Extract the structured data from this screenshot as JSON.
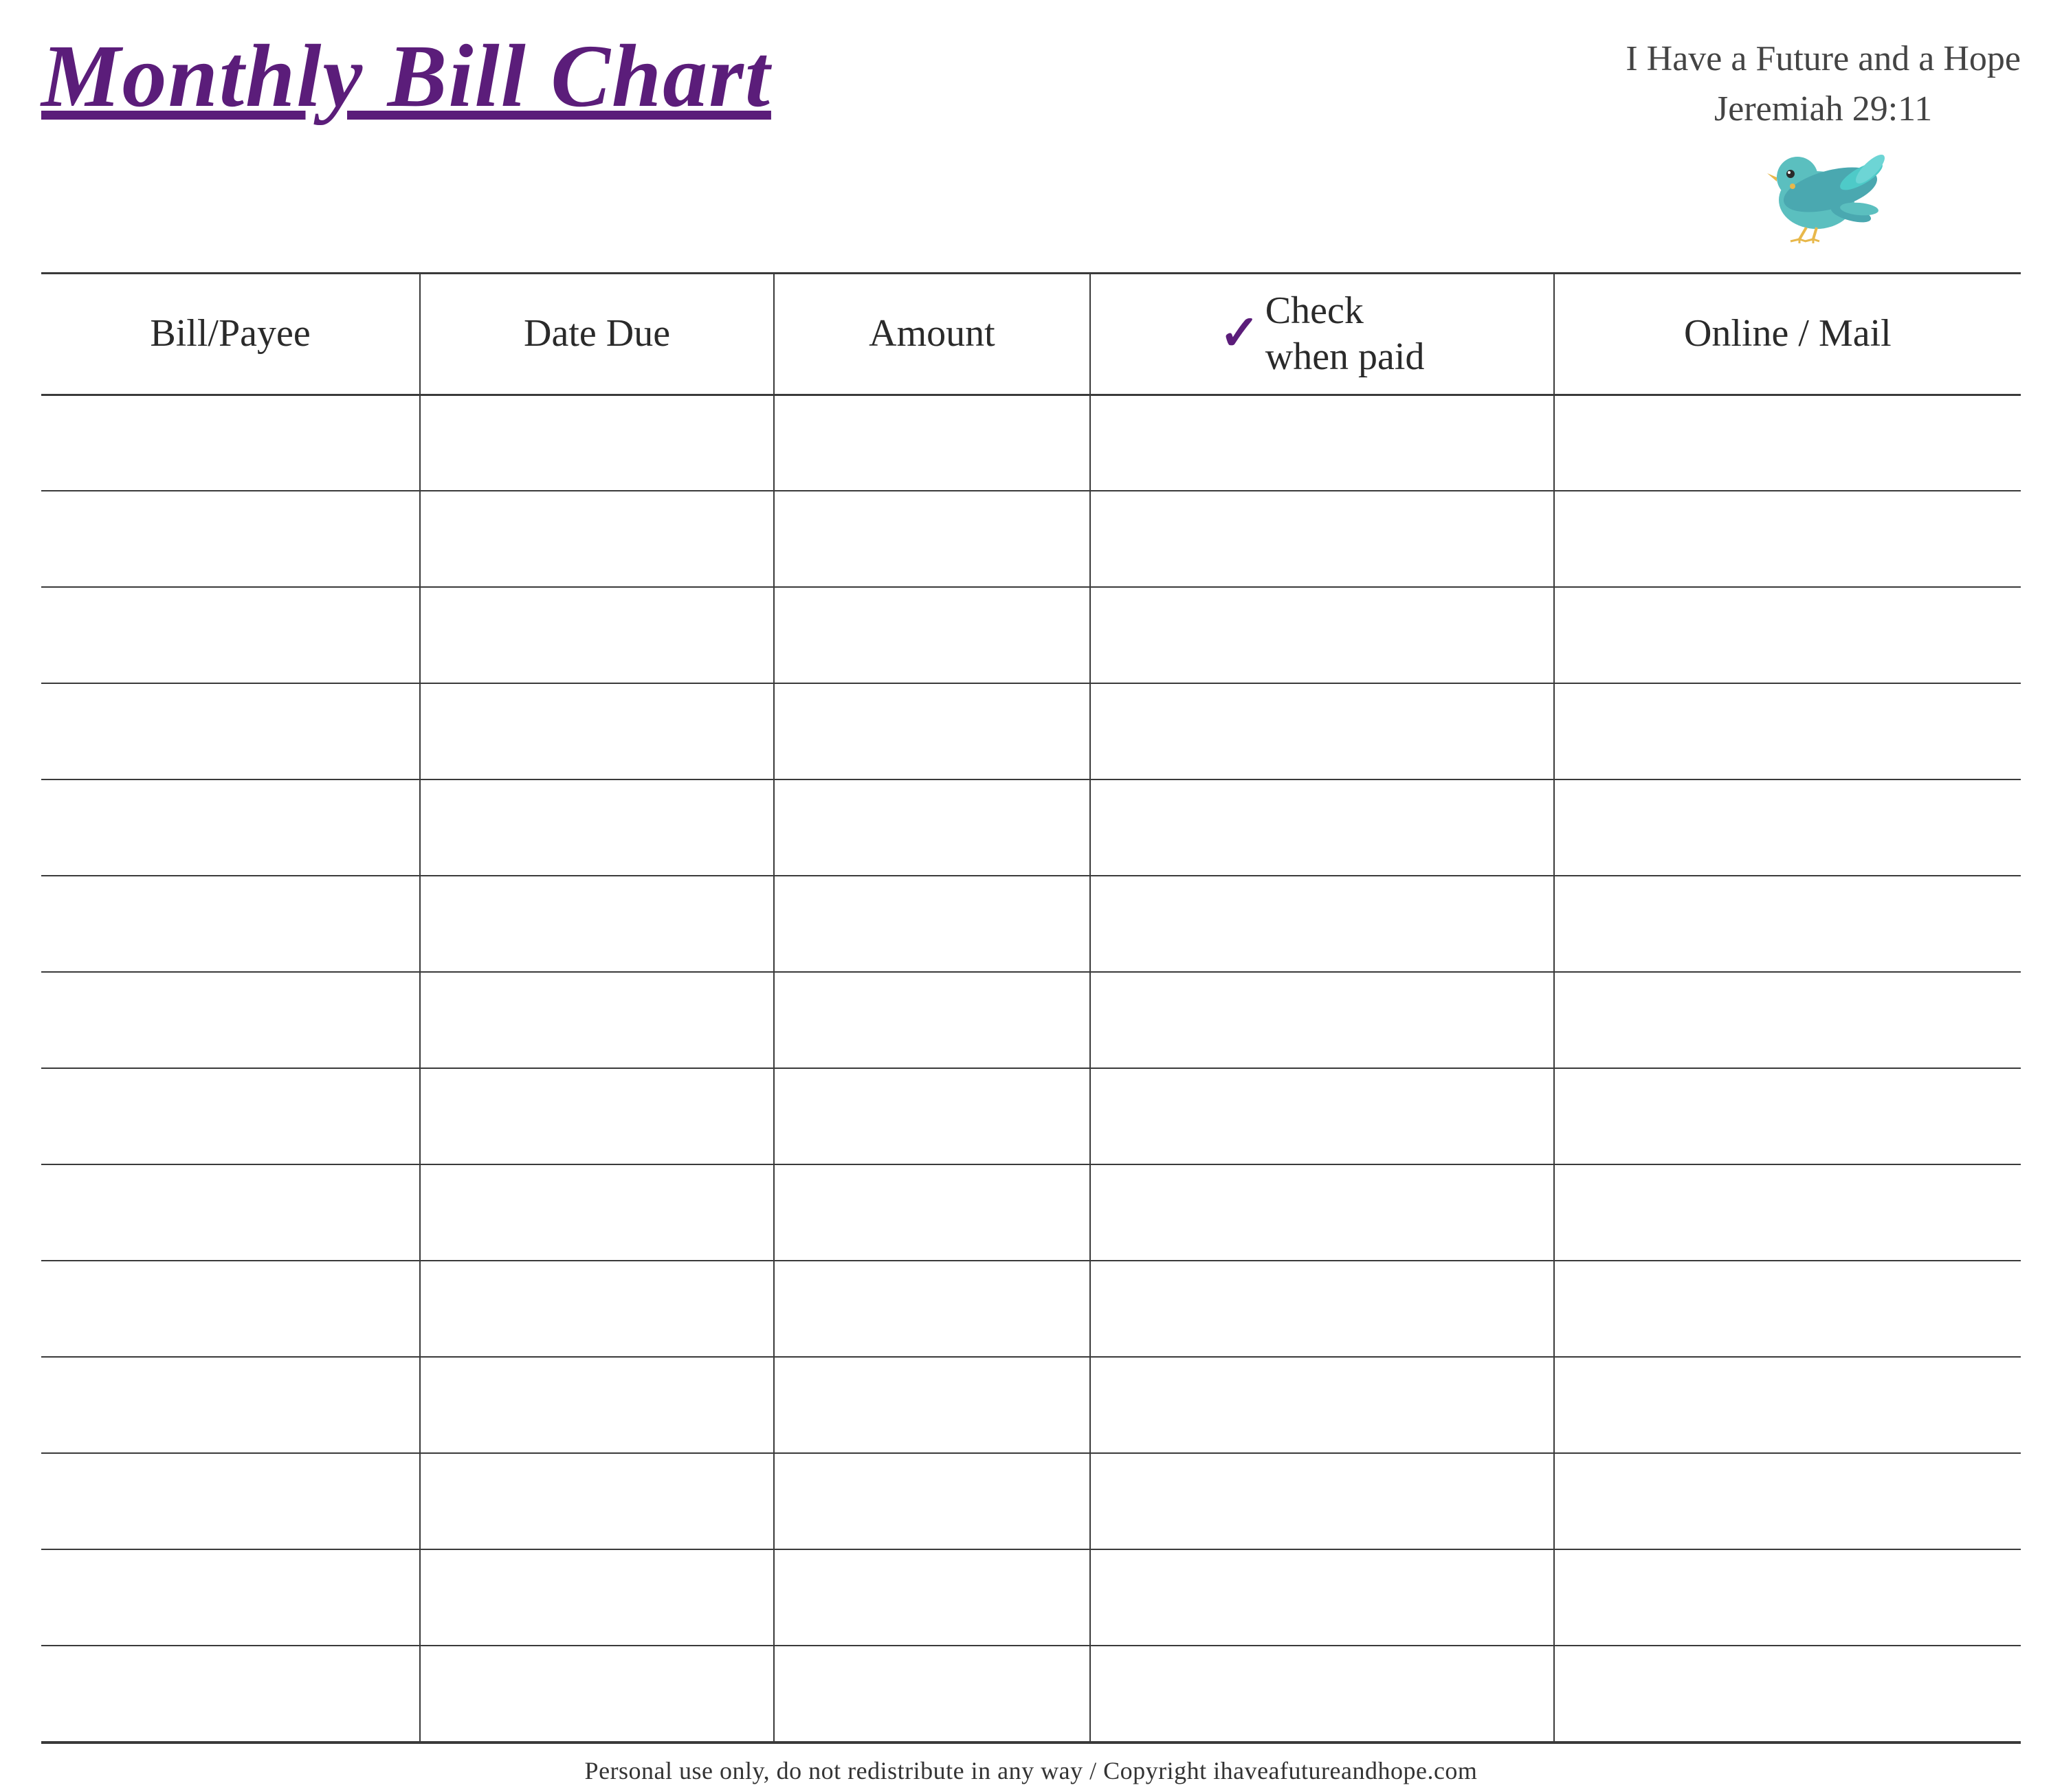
{
  "header": {
    "title": "Monthly Bill Chart",
    "subtitle_line1": "I Have a Future and a Hope",
    "subtitle_line2": "Jeremiah 29:11"
  },
  "table": {
    "columns": [
      {
        "id": "bill-payee",
        "label": "Bill/Payee"
      },
      {
        "id": "date-due",
        "label": "Date Due"
      },
      {
        "id": "amount",
        "label": "Amount"
      },
      {
        "id": "check-when-paid",
        "label_top": "Check",
        "label_bottom": "when paid",
        "has_checkmark": true
      },
      {
        "id": "online-mail",
        "label": "Online / Mail"
      }
    ],
    "row_count": 14
  },
  "footer": {
    "text": "Personal use only, do not redistribute in any way / Copyright ihaveafutureandhope.com"
  },
  "colors": {
    "title": "#5b1d7a",
    "checkmark": "#5b1d7a",
    "border": "#3a3a3a",
    "text": "#2a2a2a"
  }
}
